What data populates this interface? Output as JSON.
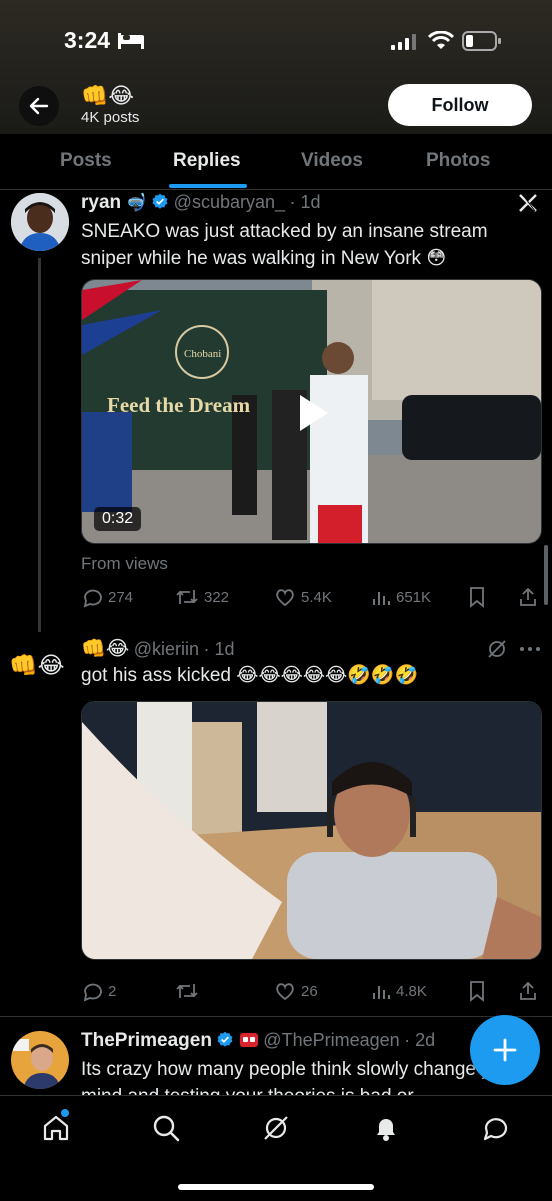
{
  "status_bar": {
    "time": "3:24"
  },
  "header": {
    "emoji": "👊😂",
    "post_count": "4K posts",
    "follow_label": "Follow"
  },
  "tabs": [
    {
      "label": "Posts"
    },
    {
      "label": "Replies"
    },
    {
      "label": "Videos"
    },
    {
      "label": "Photos"
    }
  ],
  "tweets": [
    {
      "name": "ryan",
      "handle": "@scubaryan_",
      "time": "· 1d",
      "text": "SNEAKO was just attacked by an insane stream sniper while he was walking in New York 😳",
      "video_duration": "0:32",
      "video_sign_text": "Feed the Dream",
      "video_brand": "Chobani",
      "from_label": "From views",
      "stats": {
        "replies": "274",
        "reposts": "322",
        "likes": "5.4K",
        "views": "651K"
      }
    },
    {
      "name": "👊😂",
      "handle": "@kieriin",
      "time": "· 1d",
      "side_emoji": "👊😂",
      "text": "got his ass kicked 😂😂😂😂😂🤣🤣🤣",
      "stats": {
        "replies": "2",
        "reposts": "",
        "likes": "26",
        "views": "4.8K"
      }
    },
    {
      "name": "ThePrimeagen",
      "handle": "@ThePrimeagen",
      "time": "· 2d",
      "text": "Its crazy how many people think slowly change your mind and testing your theories is bad or"
    }
  ],
  "colors": {
    "accent": "#1d9bf0",
    "muted": "#71767b",
    "border": "#2f3336"
  }
}
